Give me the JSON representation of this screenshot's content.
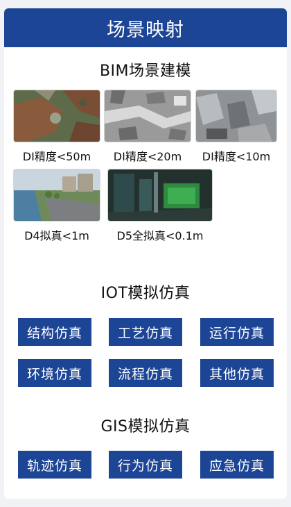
{
  "header": {
    "title": "场景映射"
  },
  "bim": {
    "title": "BIM场景建模",
    "scenes": [
      {
        "caption": "DI精度<50m",
        "image": "aerial-terrain"
      },
      {
        "caption": "DI精度<20m",
        "image": "city-grayscale-aerial"
      },
      {
        "caption": "DI精度<10m",
        "image": "city-buildings-aerial"
      },
      {
        "caption": "D4拟真<1m",
        "image": "river-street-view"
      },
      {
        "caption": "D5全拟真<0.1m",
        "image": "factory-interior"
      }
    ]
  },
  "iot": {
    "title": "IOT模拟仿真",
    "buttons": [
      "结构仿真",
      "工艺仿真",
      "运行仿真",
      "环境仿真",
      "流程仿真",
      "其他仿真"
    ]
  },
  "gis": {
    "title": "GIS模拟仿真",
    "buttons": [
      "轨迹仿真",
      "行为仿真",
      "应急仿真"
    ]
  },
  "colors": {
    "accent": "#1d4595",
    "background": "#f0f2f5",
    "card": "#ffffff"
  }
}
